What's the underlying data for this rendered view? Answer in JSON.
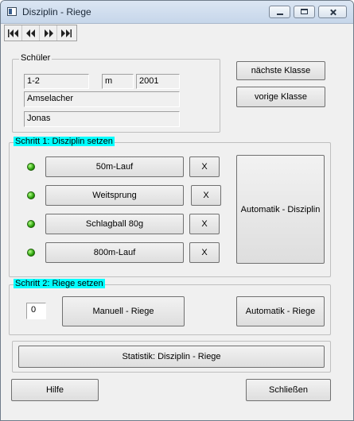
{
  "window": {
    "title": "Disziplin - Riege"
  },
  "navigator": [
    {
      "name": "first-record-icon"
    },
    {
      "name": "previous-record-icon"
    },
    {
      "name": "next-record-icon"
    },
    {
      "name": "last-record-icon"
    }
  ],
  "schueler": {
    "group_label": "Schüler",
    "klasse": "1-2",
    "geschlecht": "m",
    "jahrgang": "2001",
    "nachname": "Amselacher",
    "vorname": "Jonas",
    "next_class_label": "nächste Klasse",
    "prev_class_label": "vorige Klasse"
  },
  "step1": {
    "group_label": "Schritt 1: Disziplin setzen",
    "disciplines": [
      {
        "label": "50m-Lauf",
        "clear": "X",
        "status_color": "#2aa10a"
      },
      {
        "label": "Weitsprung",
        "clear": "X",
        "status_color": "#2aa10a"
      },
      {
        "label": "Schlagball 80g",
        "clear": "X",
        "status_color": "#2aa10a"
      },
      {
        "label": "800m-Lauf",
        "clear": "X",
        "status_color": "#2aa10a"
      }
    ],
    "auto_label": "Automatik - Disziplin"
  },
  "step2": {
    "group_label": "Schritt 2: Riege setzen",
    "riege_value": "0",
    "manual_label": "Manuell - Riege",
    "auto_label": "Automatik - Riege"
  },
  "statistik_label": "Statistik: Disziplin - Riege",
  "help_label": "Hilfe",
  "close_label": "Schließen",
  "colors": {
    "highlight": "#00ffff",
    "led": "#2aa10a"
  }
}
